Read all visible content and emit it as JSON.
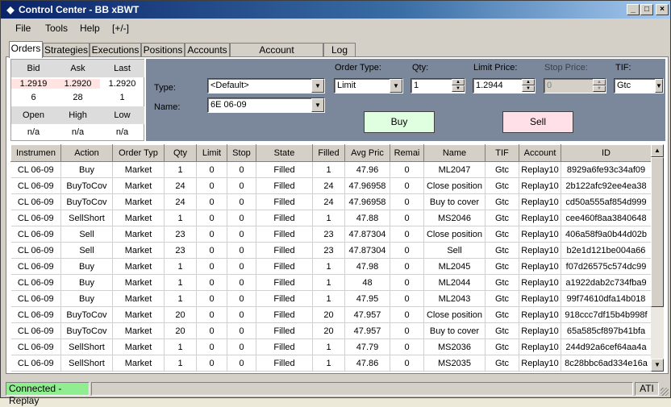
{
  "window": {
    "title": "Control Center - BB xBWT",
    "controls": [
      "_",
      "□",
      "×"
    ]
  },
  "menu": [
    "File",
    "Tools",
    "Help",
    "[+/-]"
  ],
  "tabs": [
    "Orders",
    "Strategies",
    "Executions",
    "Positions",
    "Accounts",
    "Account Performance",
    "Log"
  ],
  "active_tab": "Orders",
  "quote": {
    "headers": [
      "Bid",
      "Ask",
      "Last"
    ],
    "prices": [
      "1.2919",
      "1.2920",
      "1.2920"
    ],
    "sizes": [
      "6",
      "28",
      "1"
    ],
    "headers2": [
      "Open",
      "High",
      "Low"
    ],
    "values2": [
      "n/a",
      "n/a",
      "n/a"
    ]
  },
  "entry": {
    "type_label": "Type:",
    "type_value": "<Default>",
    "name_label": "Name:",
    "name_value": "6E 06-09",
    "order_type_label": "Order Type:",
    "order_type_value": "Limit",
    "qty_label": "Qty:",
    "qty_value": "1",
    "limit_price_label": "Limit Price:",
    "limit_price_value": "1.2944",
    "stop_price_label": "Stop Price:",
    "stop_price_value": "0",
    "tif_label": "TIF:",
    "tif_value": "Gtc",
    "buy_label": "Buy",
    "sell_label": "Sell",
    "buy_color": "#e0ffe0",
    "sell_color": "#ffe0e8"
  },
  "grid": {
    "columns": [
      "Instrumen",
      "Action",
      "Order Typ",
      "Qty",
      "Limit",
      "Stop",
      "State",
      "Filled",
      "Avg Pric",
      "Remai",
      "Name",
      "TIF",
      "Account",
      "ID"
    ],
    "rows": [
      [
        "CL 06-09",
        "Buy",
        "Market",
        "1",
        "0",
        "0",
        "Filled",
        "1",
        "47.96",
        "0",
        "ML2047",
        "Gtc",
        "Replay10",
        "8929a6fe93c34af09"
      ],
      [
        "CL 06-09",
        "BuyToCov",
        "Market",
        "24",
        "0",
        "0",
        "Filled",
        "24",
        "47.96958",
        "0",
        "Close position",
        "Gtc",
        "Replay10",
        "2b122afc92ee4ea38"
      ],
      [
        "CL 06-09",
        "BuyToCov",
        "Market",
        "24",
        "0",
        "0",
        "Filled",
        "24",
        "47.96958",
        "0",
        "Buy to cover",
        "Gtc",
        "Replay10",
        "cd50a555af854d999"
      ],
      [
        "CL 06-09",
        "SellShort",
        "Market",
        "1",
        "0",
        "0",
        "Filled",
        "1",
        "47.88",
        "0",
        "MS2046",
        "Gtc",
        "Replay10",
        "cee460f8aa3840648"
      ],
      [
        "CL 06-09",
        "Sell",
        "Market",
        "23",
        "0",
        "0",
        "Filled",
        "23",
        "47.87304",
        "0",
        "Close position",
        "Gtc",
        "Replay10",
        "406a58f9a0b44d02b"
      ],
      [
        "CL 06-09",
        "Sell",
        "Market",
        "23",
        "0",
        "0",
        "Filled",
        "23",
        "47.87304",
        "0",
        "Sell",
        "Gtc",
        "Replay10",
        "b2e1d121be004a66"
      ],
      [
        "CL 06-09",
        "Buy",
        "Market",
        "1",
        "0",
        "0",
        "Filled",
        "1",
        "47.98",
        "0",
        "ML2045",
        "Gtc",
        "Replay10",
        "f07d26575c574dc99"
      ],
      [
        "CL 06-09",
        "Buy",
        "Market",
        "1",
        "0",
        "0",
        "Filled",
        "1",
        "48",
        "0",
        "ML2044",
        "Gtc",
        "Replay10",
        "a1922dab2c734fba9"
      ],
      [
        "CL 06-09",
        "Buy",
        "Market",
        "1",
        "0",
        "0",
        "Filled",
        "1",
        "47.95",
        "0",
        "ML2043",
        "Gtc",
        "Replay10",
        "99f74610dfa14b018"
      ],
      [
        "CL 06-09",
        "BuyToCov",
        "Market",
        "20",
        "0",
        "0",
        "Filled",
        "20",
        "47.957",
        "0",
        "Close position",
        "Gtc",
        "Replay10",
        "918ccc7df15b4b998f"
      ],
      [
        "CL 06-09",
        "BuyToCov",
        "Market",
        "20",
        "0",
        "0",
        "Filled",
        "20",
        "47.957",
        "0",
        "Buy to cover",
        "Gtc",
        "Replay10",
        "65a585cf897b41bfa"
      ],
      [
        "CL 06-09",
        "SellShort",
        "Market",
        "1",
        "0",
        "0",
        "Filled",
        "1",
        "47.79",
        "0",
        "MS2036",
        "Gtc",
        "Replay10",
        "244d92a6cef64aa4a"
      ],
      [
        "CL 06-09",
        "SellShort",
        "Market",
        "1",
        "0",
        "0",
        "Filled",
        "1",
        "47.86",
        "0",
        "MS2035",
        "Gtc",
        "Replay10",
        "8c28bbc6ad334e16a"
      ]
    ]
  },
  "status": {
    "connection": "Connected - Replay",
    "connection_color": "#90ee90",
    "vendor": "ATI"
  }
}
